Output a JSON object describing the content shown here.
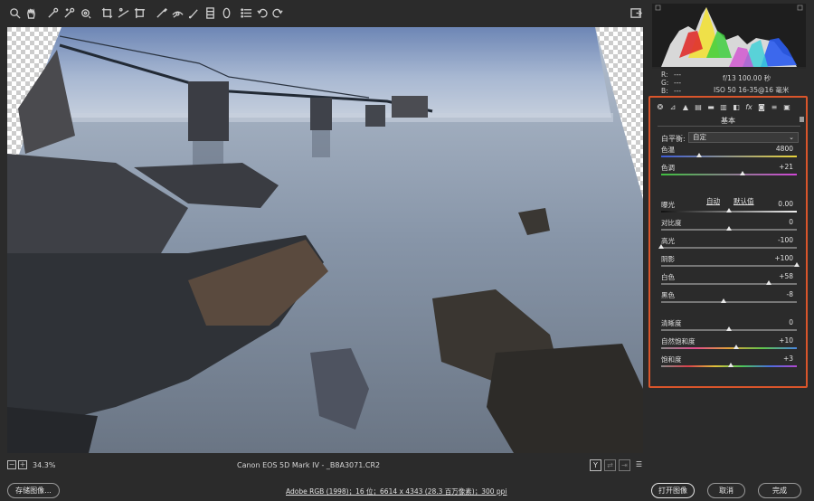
{
  "toolbar": {
    "tools": [
      {
        "name": "zoom-tool",
        "icon": "magnifier-icon"
      },
      {
        "name": "hand-tool",
        "icon": "hand-icon"
      },
      {
        "name": "white-balance-tool",
        "icon": "eyedropper-icon"
      },
      {
        "name": "color-sampler-tool",
        "icon": "eyedropper-plus-icon"
      },
      {
        "name": "targeted-adjustment-tool",
        "icon": "target-icon"
      },
      {
        "name": "crop-tool",
        "icon": "crop-icon"
      },
      {
        "name": "straighten-tool",
        "icon": "straighten-icon"
      },
      {
        "name": "transform-tool",
        "icon": "transform-icon"
      },
      {
        "name": "spot-removal-tool",
        "icon": "brush-icon"
      },
      {
        "name": "red-eye-tool",
        "icon": "eye-icon"
      },
      {
        "name": "adjustment-brush-tool",
        "icon": "adjust-brush-icon"
      },
      {
        "name": "graduated-filter-tool",
        "icon": "graduated-icon"
      },
      {
        "name": "radial-filter-tool",
        "icon": "ellipse-icon"
      },
      {
        "name": "preferences-tool",
        "icon": "list-icon"
      },
      {
        "name": "rotate-left-tool",
        "icon": "rotate-left-icon"
      },
      {
        "name": "rotate-right-tool",
        "icon": "rotate-right-icon"
      }
    ],
    "fullscreen_icon": "fullscreen-icon"
  },
  "canvas": {
    "zoom": "34.3%",
    "camera_info": "Canon EOS 5D Mark IV -  _B8A3071.CR2"
  },
  "histogram": {
    "r_label": "R:",
    "g_label": "G:",
    "b_label": "B:",
    "r_value": "---",
    "g_value": "---",
    "b_value": "---",
    "exposure": "f/13   100.00 秒",
    "lens": "ISO 50    16-35@16 毫米"
  },
  "panel": {
    "title": "基本",
    "white_balance_label": "白平衡:",
    "white_balance_value": "自定",
    "auto_label": "自动",
    "default_label": "默认值",
    "sliders": [
      {
        "key": "temp",
        "label": "色温",
        "value": "4800",
        "pos": 0.28,
        "gradient": "linear-gradient(90deg,#3d5bd8,#e8d33a)"
      },
      {
        "key": "tint",
        "label": "色调",
        "value": "+21",
        "pos": 0.6,
        "gradient": "linear-gradient(90deg,#3fbf3f,#d046d6)"
      },
      {
        "key": "exposure",
        "label": "曝光",
        "value": "0.00",
        "pos": 0.5,
        "gradient": "linear-gradient(90deg,#111,#eee)"
      },
      {
        "key": "contrast",
        "label": "对比度",
        "value": "0",
        "pos": 0.5,
        "gradient": "linear-gradient(90deg,#777,#777)"
      },
      {
        "key": "highlights",
        "label": "高光",
        "value": "-100",
        "pos": 0.0,
        "gradient": "linear-gradient(90deg,#777,#777)"
      },
      {
        "key": "shadows",
        "label": "阴影",
        "value": "+100",
        "pos": 1.0,
        "gradient": "linear-gradient(90deg,#777,#777)"
      },
      {
        "key": "whites",
        "label": "白色",
        "value": "+58",
        "pos": 0.79,
        "gradient": "linear-gradient(90deg,#777,#777)"
      },
      {
        "key": "blacks",
        "label": "黑色",
        "value": "-8",
        "pos": 0.46,
        "gradient": "linear-gradient(90deg,#777,#777)"
      },
      {
        "key": "clarity",
        "label": "清晰度",
        "value": "0",
        "pos": 0.5,
        "gradient": "linear-gradient(90deg,#777,#777)"
      },
      {
        "key": "vibrance",
        "label": "自然饱和度",
        "value": "+10",
        "pos": 0.55,
        "gradient": "linear-gradient(90deg,#8a8a8a,#e04b8c,#e0a23a,#5fc54c,#4a86e0)"
      },
      {
        "key": "saturation",
        "label": "饱和度",
        "value": "+3",
        "pos": 0.515,
        "gradient": "linear-gradient(90deg,#8a8a8a,#d9414b,#e0c13a,#4cc55a,#4a6fe0,#b047d0)"
      }
    ]
  },
  "bottombar": {
    "save_label": "存储图像...",
    "workflow": "Adobe RGB (1998)；16 位；6614 x 4343 (28.3 百万像素)；300 ppi",
    "open_label": "打开图像",
    "cancel_label": "取消",
    "done_label": "完成"
  },
  "colors": {
    "panel_highlight": "#d9552b",
    "background": "#2b2b2b"
  }
}
